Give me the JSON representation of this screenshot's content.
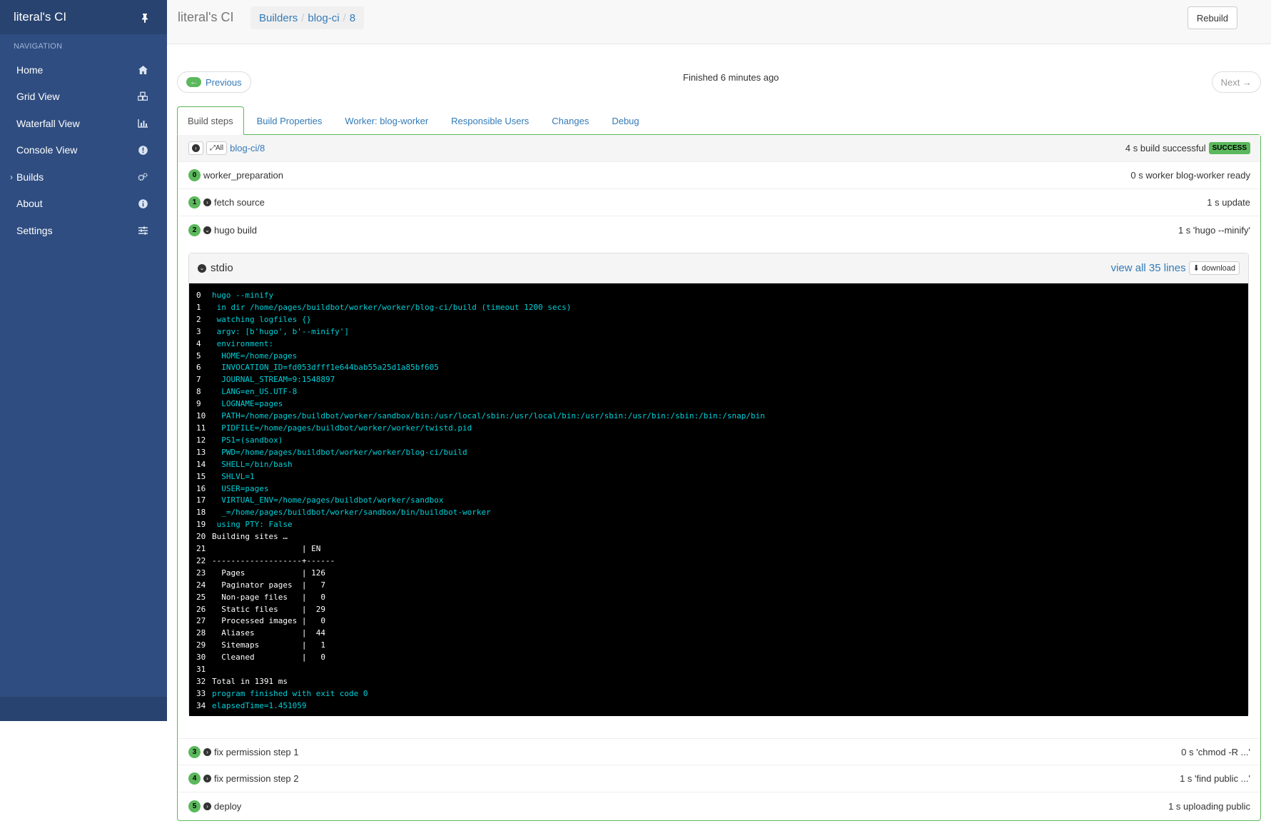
{
  "app": {
    "title": "literal's CI"
  },
  "sidebar": {
    "nav_header": "NAVIGATION",
    "items": [
      {
        "label": "Home",
        "icon": "home-icon"
      },
      {
        "label": "Grid View",
        "icon": "cubes-icon"
      },
      {
        "label": "Waterfall View",
        "icon": "bar-chart-icon"
      },
      {
        "label": "Console View",
        "icon": "exclamation-circle-icon"
      },
      {
        "label": "Builds",
        "icon": "cogs-icon"
      },
      {
        "label": "About",
        "icon": "info-circle-icon"
      },
      {
        "label": "Settings",
        "icon": "sliders-icon"
      }
    ],
    "builds_caret": "›"
  },
  "topbar": {
    "title": "literal's CI",
    "breadcrumb": [
      "Builders",
      "blog-ci",
      "8"
    ],
    "rebuild_label": "Rebuild"
  },
  "pager": {
    "prev_arrow": "←",
    "prev_label": "Previous",
    "next_label": "Next →",
    "finished": "Finished 6 minutes ago"
  },
  "tabs": [
    "Build steps",
    "Build Properties",
    "Worker: blog-worker",
    "Responsible Users",
    "Changes",
    "Debug"
  ],
  "build": {
    "all_label": "All",
    "link": "blog-ci/8",
    "summary": "4 s build successful",
    "status": "SUCCESS"
  },
  "steps": [
    {
      "num": "0",
      "name": "worker_preparation",
      "summary": "0 s worker blog-worker ready"
    },
    {
      "num": "1",
      "name": "fetch source",
      "summary": "1 s update"
    },
    {
      "num": "2",
      "name": "hugo build",
      "summary": "1 s 'hugo --minify'"
    },
    {
      "num": "3",
      "name": "fix permission step 1",
      "summary": "0 s 'chmod -R ...'"
    },
    {
      "num": "4",
      "name": "fix permission step 2",
      "summary": "1 s 'find public ...'"
    },
    {
      "num": "5",
      "name": "deploy",
      "summary": "1 s uploading public"
    }
  ],
  "stdio": {
    "title": "stdio",
    "view_all": "view all 35 lines",
    "download": "download",
    "lines": [
      {
        "n": "0",
        "t": "hugo --minify",
        "c": "cy"
      },
      {
        "n": "1",
        "t": " in dir /home/pages/buildbot/worker/worker/blog-ci/build (timeout 1200 secs)",
        "c": "cy"
      },
      {
        "n": "2",
        "t": " watching logfiles {}",
        "c": "cy"
      },
      {
        "n": "3",
        "t": " argv: [b'hugo', b'--minify']",
        "c": "cy"
      },
      {
        "n": "4",
        "t": " environment:",
        "c": "cy"
      },
      {
        "n": "5",
        "t": "  HOME=/home/pages",
        "c": "cy"
      },
      {
        "n": "6",
        "t": "  INVOCATION_ID=fd053dfff1e644bab55a25d1a85bf605",
        "c": "cy"
      },
      {
        "n": "7",
        "t": "  JOURNAL_STREAM=9:1548897",
        "c": "cy"
      },
      {
        "n": "8",
        "t": "  LANG=en_US.UTF-8",
        "c": "cy"
      },
      {
        "n": "9",
        "t": "  LOGNAME=pages",
        "c": "cy"
      },
      {
        "n": "10",
        "t": "  PATH=/home/pages/buildbot/worker/sandbox/bin:/usr/local/sbin:/usr/local/bin:/usr/sbin:/usr/bin:/sbin:/bin:/snap/bin",
        "c": "cy"
      },
      {
        "n": "11",
        "t": "  PIDFILE=/home/pages/buildbot/worker/worker/twistd.pid",
        "c": "cy"
      },
      {
        "n": "12",
        "t": "  PS1=(sandbox)",
        "c": "cy"
      },
      {
        "n": "13",
        "t": "  PWD=/home/pages/buildbot/worker/worker/blog-ci/build",
        "c": "cy"
      },
      {
        "n": "14",
        "t": "  SHELL=/bin/bash",
        "c": "cy"
      },
      {
        "n": "15",
        "t": "  SHLVL=1",
        "c": "cy"
      },
      {
        "n": "16",
        "t": "  USER=pages",
        "c": "cy"
      },
      {
        "n": "17",
        "t": "  VIRTUAL_ENV=/home/pages/buildbot/worker/sandbox",
        "c": "cy"
      },
      {
        "n": "18",
        "t": "  _=/home/pages/buildbot/worker/sandbox/bin/buildbot-worker",
        "c": "cy"
      },
      {
        "n": "19",
        "t": " using PTY: False",
        "c": "cy"
      },
      {
        "n": "20",
        "t": "Building sites …",
        "c": "wh"
      },
      {
        "n": "21",
        "t": "                   | EN",
        "c": "wh"
      },
      {
        "n": "22",
        "t": "-------------------+------",
        "c": "wh"
      },
      {
        "n": "23",
        "t": "  Pages            | 126",
        "c": "wh"
      },
      {
        "n": "24",
        "t": "  Paginator pages  |   7",
        "c": "wh"
      },
      {
        "n": "25",
        "t": "  Non-page files   |   0",
        "c": "wh"
      },
      {
        "n": "26",
        "t": "  Static files     |  29",
        "c": "wh"
      },
      {
        "n": "27",
        "t": "  Processed images |   0",
        "c": "wh"
      },
      {
        "n": "28",
        "t": "  Aliases          |  44",
        "c": "wh"
      },
      {
        "n": "29",
        "t": "  Sitemaps         |   1",
        "c": "wh"
      },
      {
        "n": "30",
        "t": "  Cleaned          |   0",
        "c": "wh"
      },
      {
        "n": "31",
        "t": "",
        "c": "wh"
      },
      {
        "n": "32",
        "t": "Total in 1391 ms",
        "c": "wh"
      },
      {
        "n": "33",
        "t": "program finished with exit code 0",
        "c": "cy"
      },
      {
        "n": "34",
        "t": "elapsedTime=1.451059",
        "c": "cy"
      }
    ]
  },
  "colors": {
    "sidebar": "#2f4d80",
    "success": "#5cb85c",
    "link": "#337ab7",
    "log_cyan": "#00d0d8"
  }
}
